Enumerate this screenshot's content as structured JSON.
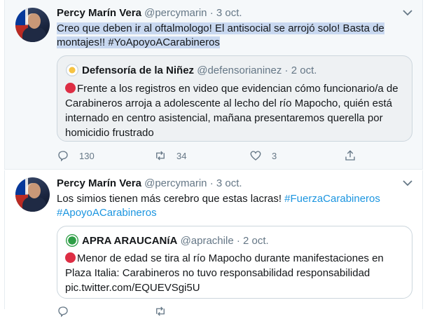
{
  "tweets": [
    {
      "author_name": "Percy Marín Vera",
      "handle": "@percymarin",
      "sep": "·",
      "date": "3 oct.",
      "text": "Creo que deben ir al oftalmologo! El antisocial se arrojó solo! Basta de montajes!! #YoApoyoACarabineros",
      "quote": {
        "author_name": "Defensoría de la Niñez",
        "handle": "@defensorianinez",
        "sep": "·",
        "date": "2 oct.",
        "text": "Frente a los registros en video que evidencian cómo funcionario/a de Carabineros arroja a adolescente al lecho del río Mapocho, quién está internado en centro asistencial, mañana presentaremos querella por homicidio frustrado"
      },
      "actions": {
        "replies": "130",
        "retweets": "34",
        "likes": "3"
      }
    },
    {
      "author_name": "Percy Marín Vera",
      "handle": "@percymarin",
      "sep": "·",
      "date": "3 oct.",
      "text_plain": "Los simios tienen más cerebro que estas lacras! ",
      "hashtag1": "#FuerzaCarabineros",
      "hashtag2": "#ApoyoACarabineros",
      "quote": {
        "author_name": "APRA ARAUCANíA",
        "handle": "@aprachile",
        "sep": "·",
        "date": "2 oct.",
        "text": "Menor de edad se tira al río Mapocho durante manifestaciones en Plaza Italia: Carabineros no tuvo responsabilidad  responsabilidad pic.twitter.com/EQUEVSgi5U"
      }
    }
  ],
  "colors": {
    "accent": "#1b95e0",
    "muted": "#657786",
    "highlight": "#c8d8f0",
    "alert": "#dd2e44"
  },
  "icons": [
    "chevron-down-icon",
    "reply-icon",
    "retweet-icon",
    "like-icon",
    "share-icon",
    "red-circle-emoji"
  ]
}
